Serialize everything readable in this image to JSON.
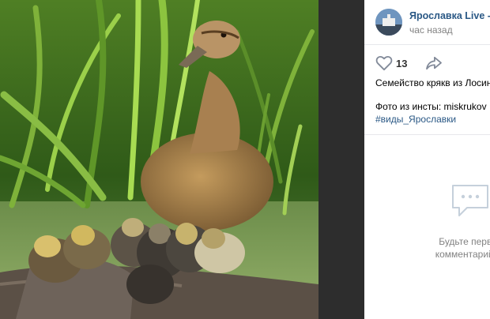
{
  "post": {
    "author": "Ярославка Live - Яр",
    "time": "час назад",
    "likes": "13",
    "text_line1": "Семейство крякв из Лосино",
    "text_line2": "Фото из инсты: miskrukov",
    "hashtag": "#виды_Ярославки"
  },
  "comments": {
    "empty_line1": "Будьте первым, кт",
    "empty_line2": "комментарий к этой"
  },
  "colors": {
    "link": "#2a5885",
    "muted": "#828282",
    "backdrop": "#2d2d2d"
  },
  "icons": [
    "heart-icon",
    "share-arrow-icon",
    "comments-empty-icon"
  ]
}
